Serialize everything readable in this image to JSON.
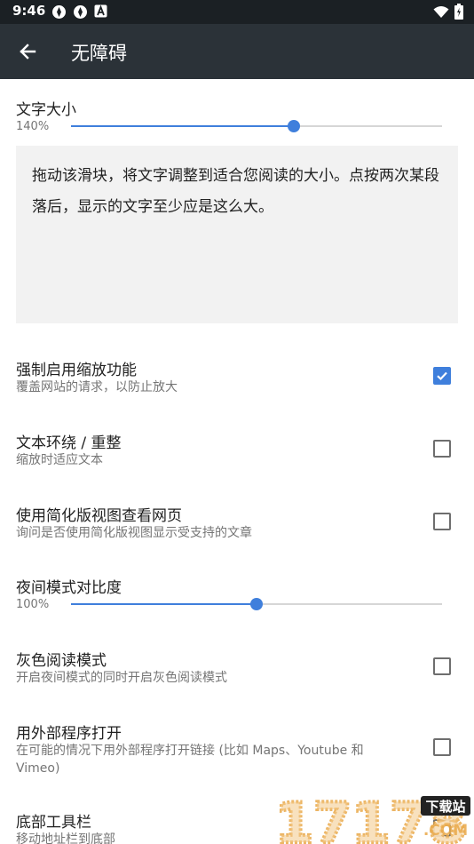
{
  "status_bar": {
    "time": "9:46",
    "left_icons": [
      "app-icon",
      "app-icon",
      "text-a-icon"
    ],
    "right_icons": [
      "wifi-icon",
      "battery-icon"
    ]
  },
  "toolbar": {
    "back_icon": "arrow-back-icon",
    "title": "无障碍"
  },
  "text_size": {
    "title": "文字大小",
    "value": "140%",
    "fraction": 0.6
  },
  "preview": {
    "text": "拖动该滑块，将文字调整到适合您阅读的大小。点按两次某段落后，显示的文字至少应是这么大。"
  },
  "prefs": [
    {
      "title": "强制启用缩放功能",
      "summary": "覆盖网站的请求，以防止放大",
      "checked": true
    },
    {
      "title": "文本环绕 / 重整",
      "summary": "缩放时适应文本",
      "checked": false
    },
    {
      "title": "使用简化版视图查看网页",
      "summary": "询问是否使用简化版视图显示受支持的文章",
      "checked": false
    }
  ],
  "night_contrast": {
    "title": "夜间模式对比度",
    "value": "100%",
    "fraction": 0.5
  },
  "prefs2": [
    {
      "title": "灰色阅读模式",
      "summary": "开启夜间模式的同时开启灰色阅读模式",
      "checked": false
    },
    {
      "title": "用外部程序打开",
      "summary": "在可能的情况下用外部程序打开链接 (比如 Maps、Youtube 和 Vimeo)",
      "checked": false
    },
    {
      "title": "底部工具栏",
      "summary": "移动地址栏到底部",
      "checked": false
    }
  ],
  "watermark": {
    "logo_text": "17178",
    "badge_text": "下载站",
    "domain_text": ".COM"
  },
  "colors": {
    "accent": "#3f7fdc",
    "toolbar": "#2b3238",
    "status_bar": "#1b2024"
  }
}
